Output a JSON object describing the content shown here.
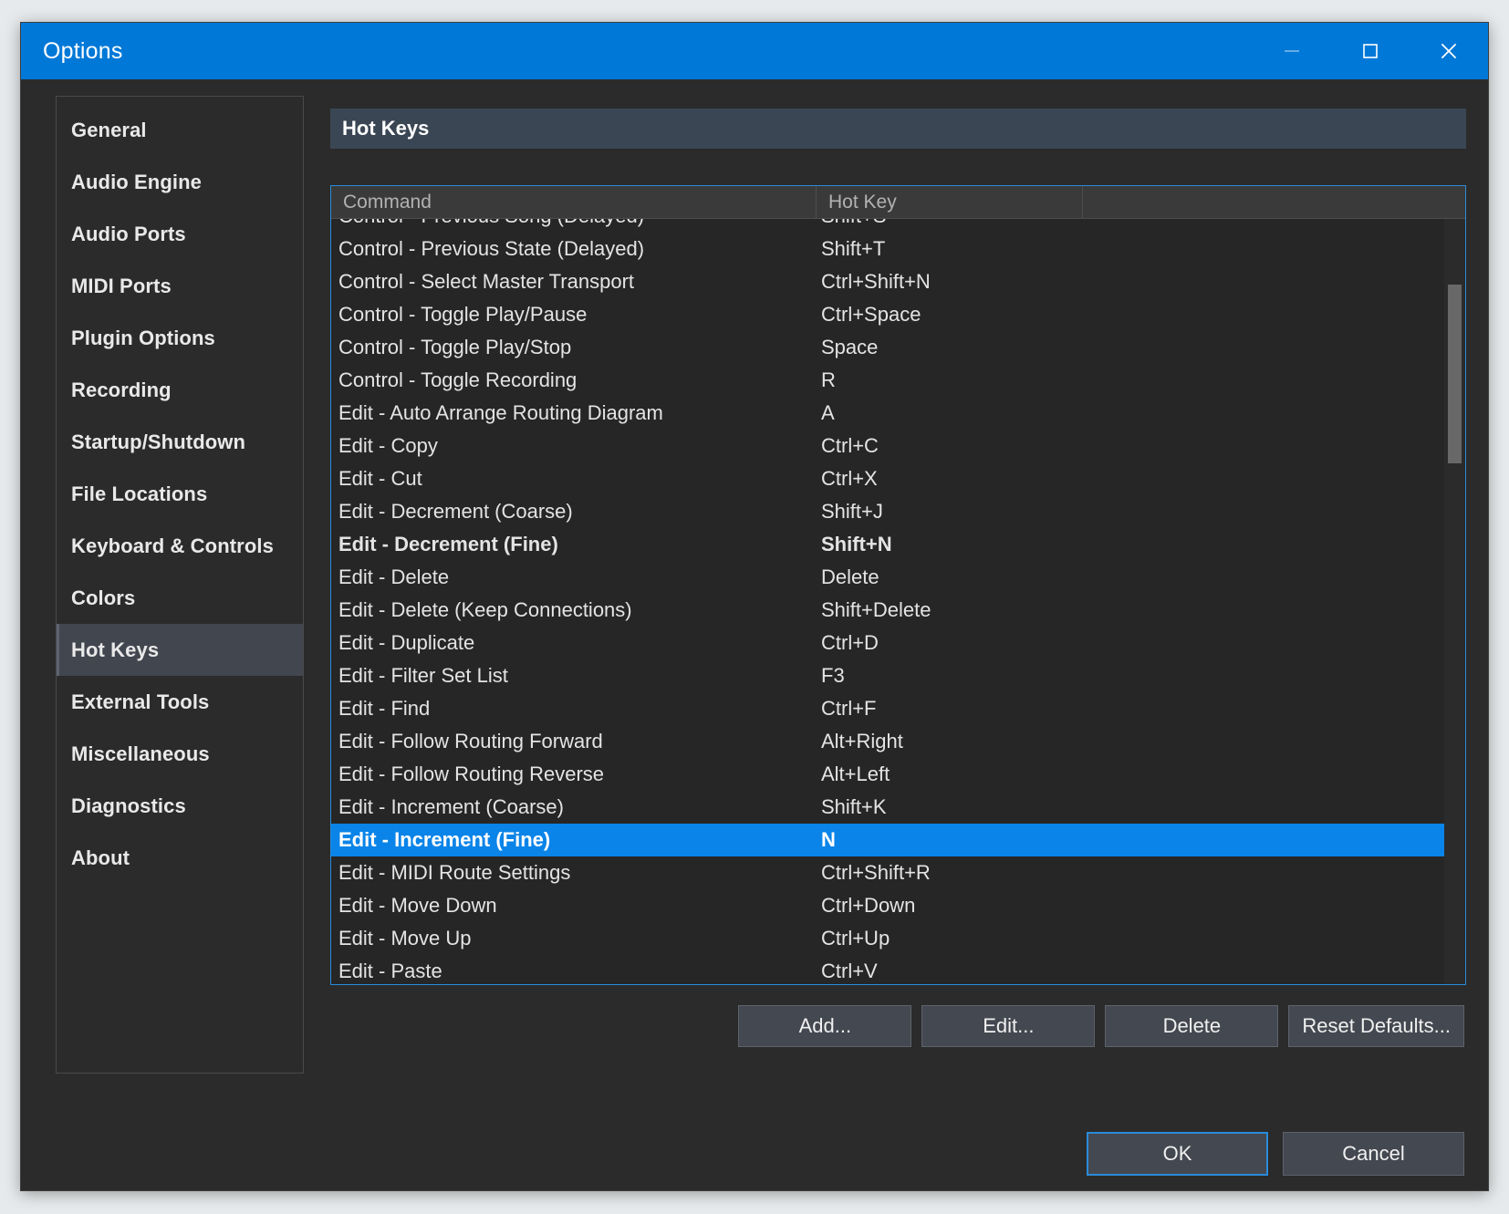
{
  "window": {
    "title": "Options",
    "controls": {
      "minimize": "minimize-icon",
      "maximize": "maximize-icon",
      "close": "close-icon"
    }
  },
  "sidebar": {
    "selected": "Hot Keys",
    "items": [
      {
        "label": "General"
      },
      {
        "label": "Audio Engine"
      },
      {
        "label": "Audio Ports"
      },
      {
        "label": "MIDI Ports"
      },
      {
        "label": "Plugin Options"
      },
      {
        "label": "Recording"
      },
      {
        "label": "Startup/Shutdown"
      },
      {
        "label": "File Locations"
      },
      {
        "label": "Keyboard & Controls"
      },
      {
        "label": "Colors"
      },
      {
        "label": "Hot Keys"
      },
      {
        "label": "External Tools"
      },
      {
        "label": "Miscellaneous"
      },
      {
        "label": "Diagnostics"
      },
      {
        "label": "About"
      }
    ]
  },
  "content": {
    "section_title": "Hot Keys",
    "table": {
      "columns": [
        "Command",
        "Hot Key",
        ""
      ],
      "rows": [
        {
          "command": "Control - Previous Song (Delayed)",
          "hotkey": "Shift+S",
          "bold": false,
          "selected": false
        },
        {
          "command": "Control - Previous State (Delayed)",
          "hotkey": "Shift+T",
          "bold": false,
          "selected": false
        },
        {
          "command": "Control - Select Master Transport",
          "hotkey": "Ctrl+Shift+N",
          "bold": false,
          "selected": false
        },
        {
          "command": "Control - Toggle Play/Pause",
          "hotkey": "Ctrl+Space",
          "bold": false,
          "selected": false
        },
        {
          "command": "Control - Toggle Play/Stop",
          "hotkey": "Space",
          "bold": false,
          "selected": false
        },
        {
          "command": "Control - Toggle Recording",
          "hotkey": "R",
          "bold": false,
          "selected": false
        },
        {
          "command": "Edit - Auto Arrange Routing Diagram",
          "hotkey": "A",
          "bold": false,
          "selected": false
        },
        {
          "command": "Edit - Copy",
          "hotkey": "Ctrl+C",
          "bold": false,
          "selected": false
        },
        {
          "command": "Edit - Cut",
          "hotkey": "Ctrl+X",
          "bold": false,
          "selected": false
        },
        {
          "command": "Edit - Decrement (Coarse)",
          "hotkey": "Shift+J",
          "bold": false,
          "selected": false
        },
        {
          "command": "Edit - Decrement (Fine)",
          "hotkey": "Shift+N",
          "bold": true,
          "selected": false
        },
        {
          "command": "Edit - Delete",
          "hotkey": "Delete",
          "bold": false,
          "selected": false
        },
        {
          "command": "Edit - Delete (Keep Connections)",
          "hotkey": "Shift+Delete",
          "bold": false,
          "selected": false
        },
        {
          "command": "Edit - Duplicate",
          "hotkey": "Ctrl+D",
          "bold": false,
          "selected": false
        },
        {
          "command": "Edit - Filter Set List",
          "hotkey": "F3",
          "bold": false,
          "selected": false
        },
        {
          "command": "Edit - Find",
          "hotkey": "Ctrl+F",
          "bold": false,
          "selected": false
        },
        {
          "command": "Edit - Follow Routing Forward",
          "hotkey": "Alt+Right",
          "bold": false,
          "selected": false
        },
        {
          "command": "Edit - Follow Routing Reverse",
          "hotkey": "Alt+Left",
          "bold": false,
          "selected": false
        },
        {
          "command": "Edit - Increment (Coarse)",
          "hotkey": "Shift+K",
          "bold": false,
          "selected": false
        },
        {
          "command": "Edit - Increment (Fine)",
          "hotkey": "N",
          "bold": true,
          "selected": true
        },
        {
          "command": "Edit - MIDI Route Settings",
          "hotkey": "Ctrl+Shift+R",
          "bold": false,
          "selected": false
        },
        {
          "command": "Edit - Move Down",
          "hotkey": "Ctrl+Down",
          "bold": false,
          "selected": false
        },
        {
          "command": "Edit - Move Up",
          "hotkey": "Ctrl+Up",
          "bold": false,
          "selected": false
        },
        {
          "command": "Edit - Paste",
          "hotkey": "Ctrl+V",
          "bold": false,
          "selected": false
        }
      ]
    },
    "actions": [
      {
        "label": "Add..."
      },
      {
        "label": "Edit..."
      },
      {
        "label": "Delete"
      },
      {
        "label": "Reset Defaults..."
      }
    ]
  },
  "footer": {
    "ok": "OK",
    "cancel": "Cancel"
  },
  "colors": {
    "titlebar": "#0078d7",
    "accent": "#0a84e8",
    "selection": "#0a84e8",
    "section_header": "#3a4654",
    "dialog_bg": "#2b2b2b",
    "table_bg": "#262626",
    "button_bg": "#444850",
    "focus_border": "#2a8bda"
  }
}
